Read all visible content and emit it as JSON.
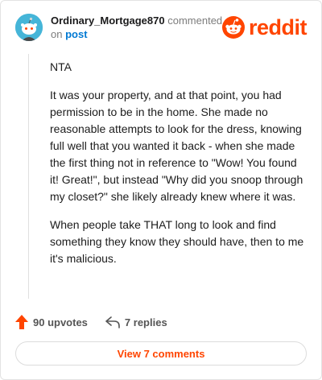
{
  "header": {
    "username": "Ordinary_Mortgage870",
    "action": "commented",
    "on_word": "on",
    "post_link": "post",
    "brand": "reddit",
    "avatar_icon": "snoo-avatar-icon",
    "brand_icon": "reddit-logo-icon",
    "brand_color": "#ff4500"
  },
  "comment": {
    "paragraphs": [
      "NTA",
      "It was your property, and at that point, you had permission to be in the home. She made no reasonable attempts to look for the dress, knowing full well that you wanted it back - when she made the first thing not in reference to \"Wow! You found it! Great!\", but instead \"Why did you snoop through my closet?\" she likely already knew where it was.",
      "When people take THAT long to look and find something they know they should have, then to me it's malicious."
    ]
  },
  "actions": {
    "upvotes": "90 upvotes",
    "replies": "7 replies",
    "upvote_icon": "upvote-arrow-icon",
    "reply_icon": "reply-arrow-icon"
  },
  "footer": {
    "view_label": "View 7 comments"
  }
}
